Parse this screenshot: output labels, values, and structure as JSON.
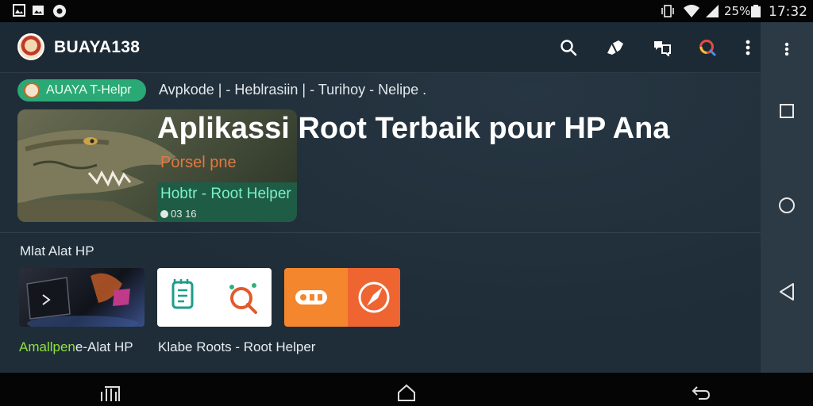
{
  "status_bar": {
    "battery_percent": "25%",
    "time": "17:32",
    "icons": [
      "gallery-icon",
      "image-icon",
      "record-icon",
      "vibrate-icon",
      "wifi-icon",
      "signal-icon",
      "battery-icon"
    ]
  },
  "app_bar": {
    "title": "BUAYA138",
    "actions": [
      "search-icon",
      "brush-icon",
      "translate-icon",
      "lens-icon",
      "more-icon"
    ]
  },
  "chip": {
    "label": "AUAYA T-Helpr"
  },
  "breadcrumb": "Avpkode | - Heblrasiin | - Turihoy - Nelipe .",
  "hero": {
    "headline": "Aplikassi Root Terbaik pour HP Ana",
    "subtitle": "Porsel pne",
    "tag": "Hobtr - Root Helper",
    "meta": "03 16"
  },
  "section": {
    "title": "Mlat Alat HP",
    "caption_1_green": "Amallpen",
    "caption_1_white": "e-Alat HP",
    "caption_2": "Klabe Roots - Root Helper"
  },
  "colors": {
    "background": "#1f2d38",
    "chip": "#2aa876",
    "accent_orange": "#f4862d",
    "accent_green": "#8de23d"
  }
}
